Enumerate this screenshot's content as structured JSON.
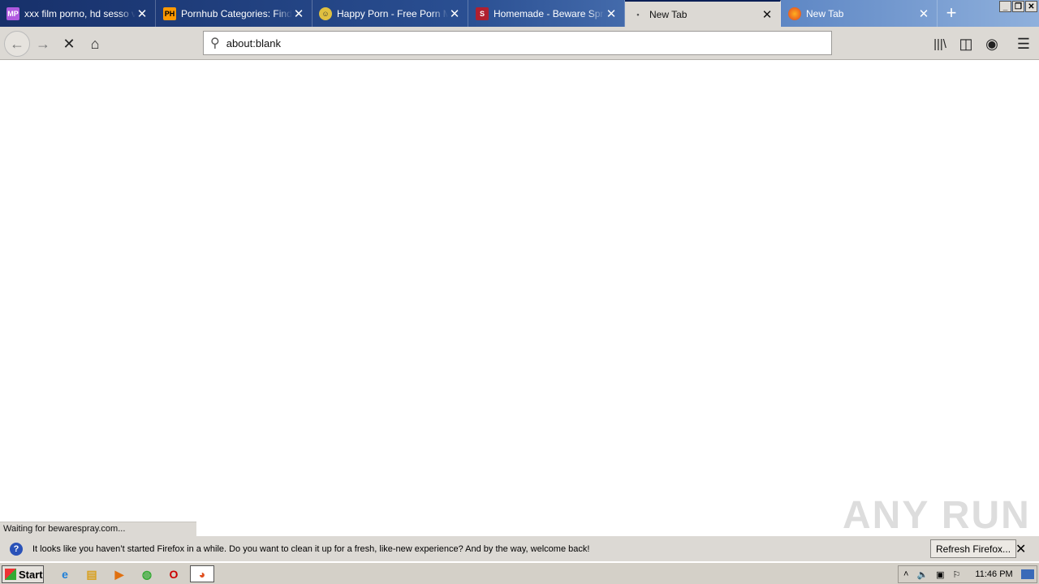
{
  "tabs": [
    {
      "title": "xxx film porno, hd sesso vid",
      "favicon": "MP",
      "fav_color": "#b05ae0"
    },
    {
      "title": "Pornhub Categories: Find W",
      "favicon": "PH",
      "fav_color": "#f90"
    },
    {
      "title": "Happy Porn - Free Porn Mo",
      "favicon": "☺",
      "fav_color": "#e0c040"
    },
    {
      "title": "Homemade - Beware Spray",
      "favicon": "S",
      "fav_color": "#b02030"
    },
    {
      "title": "New Tab",
      "favicon": "•",
      "fav_color": "transparent",
      "active": true
    },
    {
      "title": "New Tab",
      "favicon": "firefox-icon",
      "fav_color": "#f06020"
    }
  ],
  "url": {
    "value": "about:blank"
  },
  "status": "Waiting for bewarespray.com...",
  "watermark": "ANY RUN",
  "notification": {
    "text": "It looks like you haven’t started Firefox in a while. Do you want to clean it up for a fresh, like-new experience? And by the way, welcome back!",
    "button": "Refresh Firefox..."
  },
  "taskbar": {
    "start": "Start",
    "clock": "11:46 PM"
  }
}
